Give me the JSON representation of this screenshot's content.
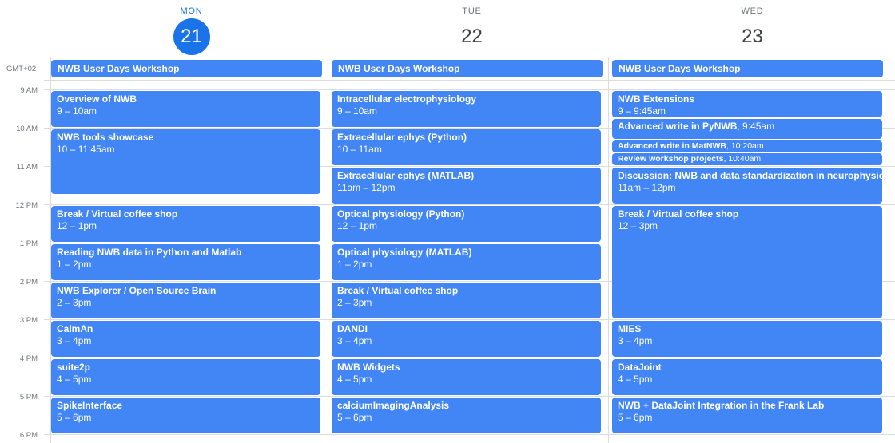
{
  "timezone_label": "GMT+02",
  "days": [
    {
      "dow": "MON",
      "date": "21",
      "today": true
    },
    {
      "dow": "TUE",
      "date": "22",
      "today": false
    },
    {
      "dow": "WED",
      "date": "23",
      "today": false
    }
  ],
  "hours": [
    "9 AM",
    "10 AM",
    "11 AM",
    "12 PM",
    "1 PM",
    "2 PM",
    "3 PM",
    "4 PM",
    "5 PM",
    "6 PM"
  ],
  "allday_events": [
    {
      "title": "NWB User Days Workshop"
    },
    {
      "title": "NWB User Days Workshop"
    },
    {
      "title": "NWB User Days Workshop"
    }
  ],
  "events": {
    "mon": [
      {
        "title": "Overview of NWB",
        "time": "9 – 10am"
      },
      {
        "title": "NWB tools showcase",
        "time": "10 – 11:45am"
      },
      {
        "title": "Break / Virtual coffee shop",
        "time": "12 – 1pm"
      },
      {
        "title": "Reading NWB data in Python and Matlab",
        "time": "1 – 2pm"
      },
      {
        "title": "NWB Explorer / Open Source Brain",
        "time": "2 – 3pm"
      },
      {
        "title": "CalmAn",
        "time": "3 – 4pm"
      },
      {
        "title": "suite2p",
        "time": "4 – 5pm"
      },
      {
        "title": "SpikeInterface",
        "time": "5 – 6pm"
      }
    ],
    "tue": [
      {
        "title": "Intracellular electrophysiology",
        "time": "9 – 10am"
      },
      {
        "title": "Extracellular ephys (Python)",
        "time": "10 – 11am"
      },
      {
        "title": "Extracellular ephys (MATLAB)",
        "time": "11am – 12pm"
      },
      {
        "title": "Optical physiology (Python)",
        "time": "12 – 1pm"
      },
      {
        "title": "Optical physiology (MATLAB)",
        "time": "1 – 2pm"
      },
      {
        "title": "Break / Virtual coffee shop",
        "time": "2 – 3pm"
      },
      {
        "title": "DANDI",
        "time": "3 – 4pm"
      },
      {
        "title": "NWB Widgets",
        "time": "4 – 5pm"
      },
      {
        "title": "calciumImagingAnalysis",
        "time": "5 – 6pm"
      }
    ],
    "wed": [
      {
        "title": "NWB Extensions",
        "time": "9 – 9:45am"
      },
      {
        "title": "Advanced write in PyNWB",
        "time": "9:45am"
      },
      {
        "title": "Advanced write in MatNWB",
        "time": "10:20am"
      },
      {
        "title": "Review workshop projects",
        "time": "10:40am"
      },
      {
        "title": "Discussion: NWB and data standardization in neurophysiology",
        "time": "11am – 12pm"
      },
      {
        "title": "Break / Virtual coffee shop",
        "time": "12 – 3pm"
      },
      {
        "title": "MIES",
        "time": "3 – 4pm"
      },
      {
        "title": "DataJoint",
        "time": "4 – 5pm"
      },
      {
        "title": "NWB + DataJoint Integration in the Frank Lab",
        "time": "5 – 6pm"
      }
    ]
  },
  "colors": {
    "event": "#4285f4",
    "today_accent": "#1a73e8",
    "grid": "#dadce0",
    "muted_text": "#70757a"
  }
}
